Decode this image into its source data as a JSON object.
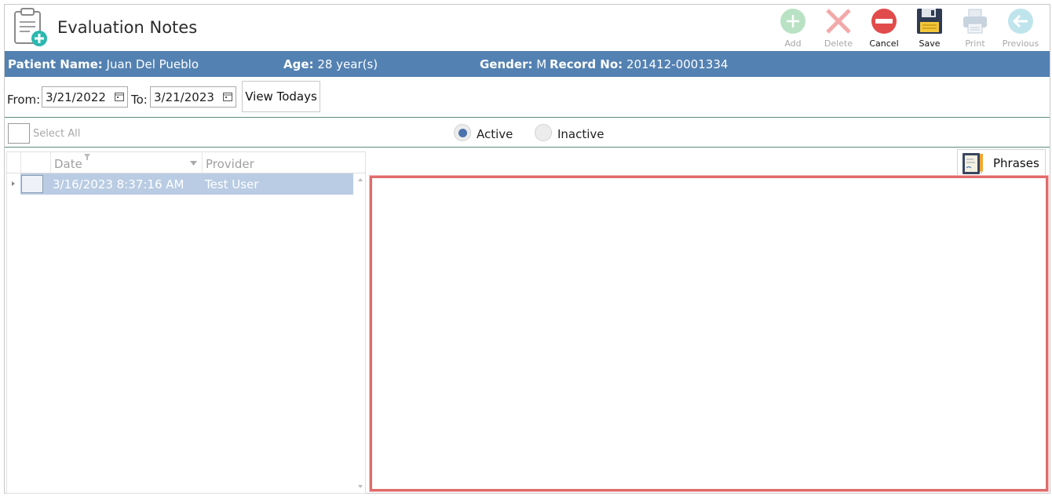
{
  "header": {
    "title": "Evaluation Notes",
    "toolbar": [
      {
        "name": "add-button",
        "label": "Add",
        "icon": "plus-circle-icon",
        "enabled": false
      },
      {
        "name": "delete-button",
        "label": "Delete",
        "icon": "x-icon",
        "enabled": false
      },
      {
        "name": "cancel-button",
        "label": "Cancel",
        "icon": "minus-circle-icon",
        "enabled": true
      },
      {
        "name": "save-button",
        "label": "Save",
        "icon": "floppy-disk-icon",
        "enabled": true
      },
      {
        "name": "print-button",
        "label": "Print",
        "icon": "printer-icon",
        "enabled": false
      },
      {
        "name": "previous-button",
        "label": "Previous",
        "icon": "arrow-left-circle-icon",
        "enabled": false
      }
    ]
  },
  "patient": {
    "name_label": "Patient Name:",
    "name": "Juan Del Pueblo",
    "age_label": "Age:",
    "age": "28 year(s)",
    "gender_label": "Gender:",
    "gender": "M",
    "record_label": "Record No:",
    "record": "201412-0001334"
  },
  "filter": {
    "from_label": "From:",
    "from_date": "3/21/2022",
    "to_label": "To:",
    "to_date": "3/21/2023",
    "view_todays": "View Todays"
  },
  "selection": {
    "select_all": "Select All",
    "active": "Active",
    "inactive": "Inactive",
    "selected": "Active"
  },
  "grid": {
    "columns": [
      "Date",
      "Provider"
    ],
    "rows": [
      {
        "date": "3/16/2023 8:37:16 AM",
        "provider": "Test User"
      }
    ]
  },
  "phrases_label": "Phrases",
  "colors": {
    "patient_bar": "#5381b2",
    "row_selected": "#b9cce3",
    "notes_border": "#e06b6b",
    "radio_dot": "#4b74ad"
  }
}
